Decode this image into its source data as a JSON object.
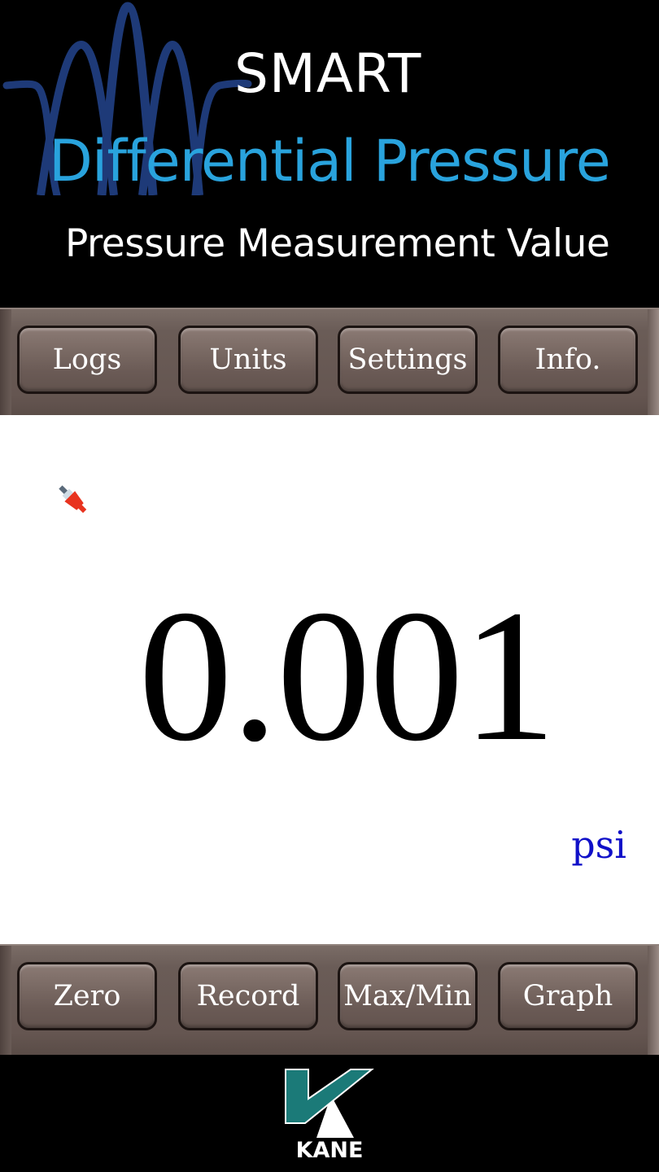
{
  "header": {
    "brand_word": "SMART",
    "title": "Differential Pressure",
    "subtitle": "Pressure Measurement Value",
    "logo_icon": "waveform-icon"
  },
  "top_toolbar": {
    "buttons": [
      {
        "label": "Logs"
      },
      {
        "label": "Units"
      },
      {
        "label": "Settings"
      },
      {
        "label": "Info."
      }
    ]
  },
  "display": {
    "probe_icon": "probe-connector-icon",
    "reading": "0.001",
    "unit": "psi"
  },
  "bottom_toolbar": {
    "buttons": [
      {
        "label": "Zero"
      },
      {
        "label": "Record"
      },
      {
        "label": "Max/Min"
      },
      {
        "label": "Graph"
      }
    ]
  },
  "footer": {
    "brand": "KANE"
  },
  "colors": {
    "title_blue": "#29a3dd",
    "wave_blue": "#1e3a78",
    "unit_blue": "#1010c8",
    "toolbar": "#6a5c57",
    "kane_teal": "#1b7a78"
  }
}
